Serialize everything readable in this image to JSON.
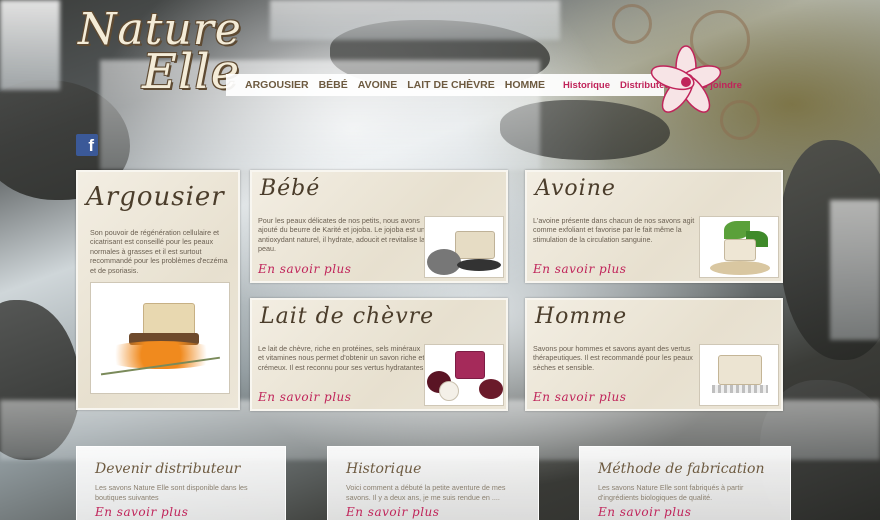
{
  "logo": {
    "line1": "Nature",
    "line2": "Elle"
  },
  "nav": {
    "main": [
      "ARGOUSIER",
      "BÉBÉ",
      "AVOINE",
      "LAIT DE CHÈVRE",
      "HOMME"
    ],
    "alt": [
      "Historique",
      "Distributeur",
      "Nous joindre"
    ]
  },
  "facebook": {
    "letter": "f"
  },
  "featured": {
    "title": "Argousier",
    "text": "Son pouvoir de régénération cellulaire et cicatrisant est conseillé pour les peaux normales à grasses et il est surtout recommandé pour les problèmes d'eczéma et de psoriasis."
  },
  "products": [
    {
      "title": "Bébé",
      "text": "Pour les peaux délicates de nos petits, nous avons ajouté du beurre de Karité et jojoba. Le jojoba est un antioxydant naturel, il hydrate, adoucit et revitalise la peau.",
      "more": "En savoir plus"
    },
    {
      "title": "Avoine",
      "text": "L'avoine présente dans chacun de nos savons agit comme exfoliant et favorise par le fait même la stimulation de la circulation sanguine.",
      "more": "En savoir plus"
    },
    {
      "title": "Lait de chèvre",
      "text": "Le lait de chèvre, riche en protéines, sels minéraux et vitamines nous permet d'obtenir un savon riche et crémeux. Il est reconnu pour ses vertus hydratantes",
      "more": "En savoir plus"
    },
    {
      "title": "Homme",
      "text": "Savons pour hommes et savons ayant des vertus thérapeutiques. Il est recommandé pour les peaux sèches et sensible.",
      "more": "En savoir plus"
    }
  ],
  "bottom": [
    {
      "title": "Devenir distributeur",
      "text": "Les savons Nature Elle sont disponible dans les boutiques suivantes",
      "more": "En savoir plus"
    },
    {
      "title": "Historique",
      "text": "Voici comment a débuté la petite aventure de mes savons.  Il y a deux ans, je me suis rendue en   ....",
      "more": "En savoir plus"
    },
    {
      "title": "Méthode de fabrication",
      "text": "Les savons Nature Elle sont fabriqués à partir d'ingrédients biologiques de qualité.",
      "more": "En savoir plus"
    }
  ],
  "colors": {
    "accent": "#c0245a",
    "brown": "#6d5a40",
    "facebook": "#3b5998"
  }
}
